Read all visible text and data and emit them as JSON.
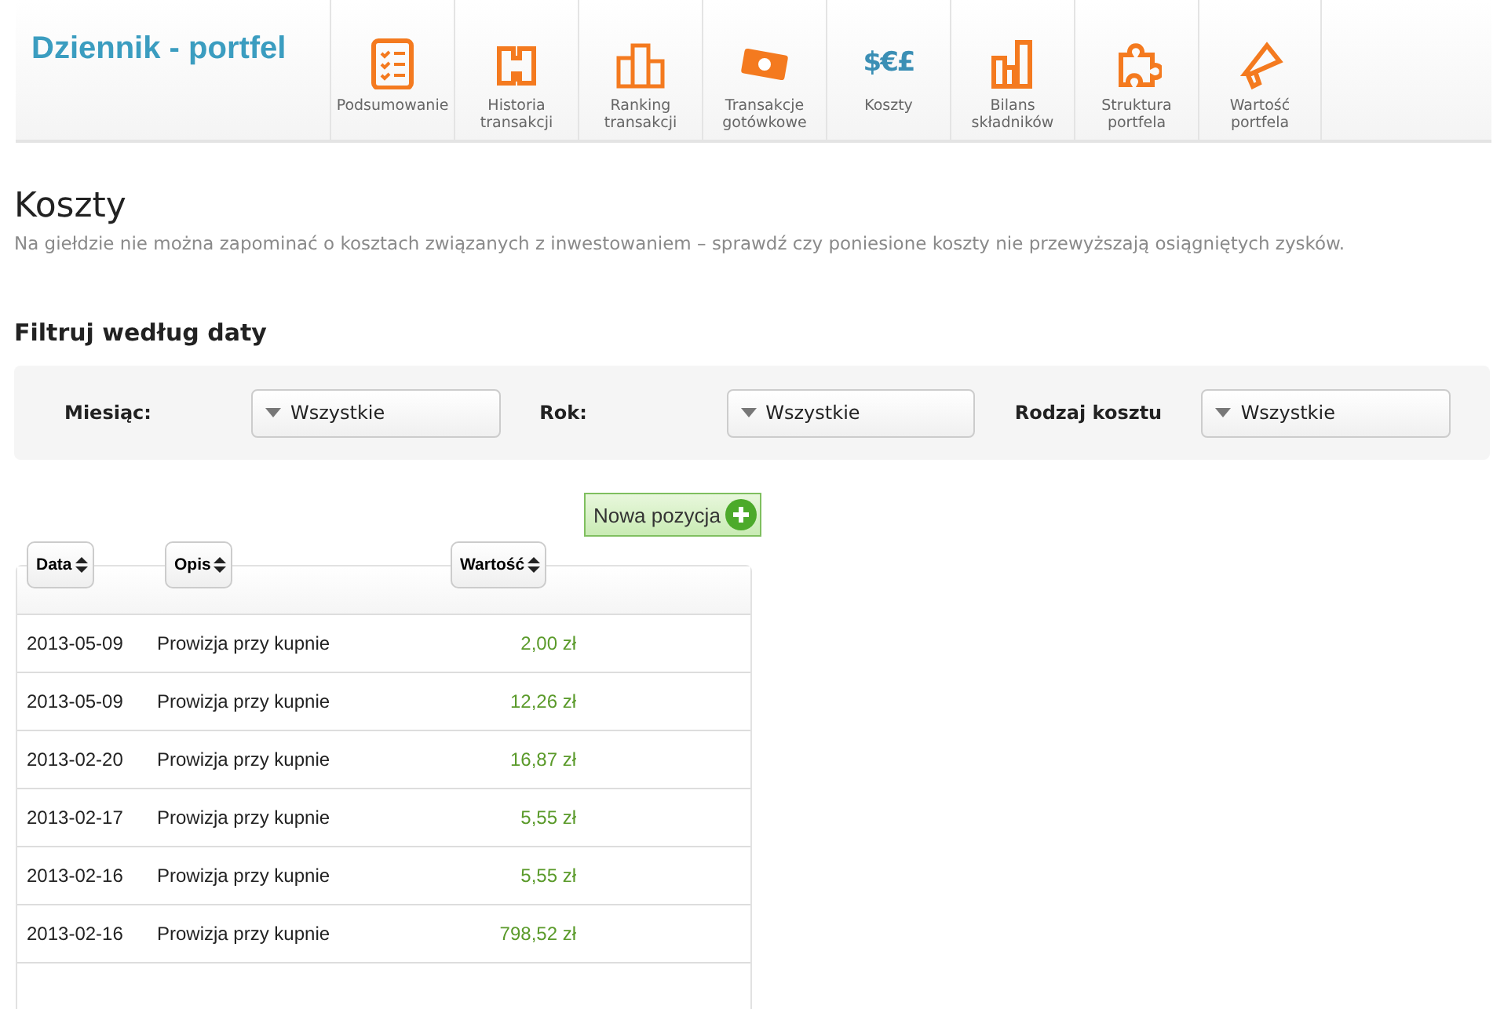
{
  "app_title": "Dziennik - portfel",
  "nav": [
    {
      "label": "Podsumowanie",
      "selected": false
    },
    {
      "label": "Historia transakcji",
      "selected": false
    },
    {
      "label": "Ranking transakcji",
      "selected": false
    },
    {
      "label": "Transakcje gotówkowe",
      "selected": false
    },
    {
      "label": "Koszty",
      "selected": true,
      "glyph": "$€£"
    },
    {
      "label": "Bilans składników",
      "selected": false
    },
    {
      "label": "Struktura portfela",
      "selected": false
    },
    {
      "label": "Wartość portfela",
      "selected": false
    }
  ],
  "page_title": "Koszty",
  "subtitle": "Na giełdzie nie można zapominać o kosztach związanych z inwestowaniem – sprawdź czy poniesione koszty nie przewyższają osiągniętych zysków.",
  "filter_heading": "Filtruj według daty",
  "filters": [
    {
      "label": "Miesiąc:",
      "value": "Wszystkie"
    },
    {
      "label": "Rok:",
      "value": "Wszystkie"
    },
    {
      "label": "Rodzaj kosztu",
      "value": "Wszystkie"
    }
  ],
  "add_button": "Nowa pozycja",
  "table": {
    "columns": [
      "Data",
      "Opis",
      "Wartość"
    ],
    "rows": [
      [
        "2013-05-09",
        "Prowizja przy kupnie",
        "2,00 zł"
      ],
      [
        "2013-05-09",
        "Prowizja przy kupnie",
        "12,26 zł"
      ],
      [
        "2013-02-20",
        "Prowizja przy kupnie",
        "16,87 zł"
      ],
      [
        "2013-02-17",
        "Prowizja przy kupnie",
        "5,55 zł"
      ],
      [
        "2013-02-16",
        "Prowizja przy kupnie",
        "5,55 zł"
      ],
      [
        "2013-02-16",
        "Prowizja przy kupnie",
        "798,52 zł"
      ]
    ]
  }
}
